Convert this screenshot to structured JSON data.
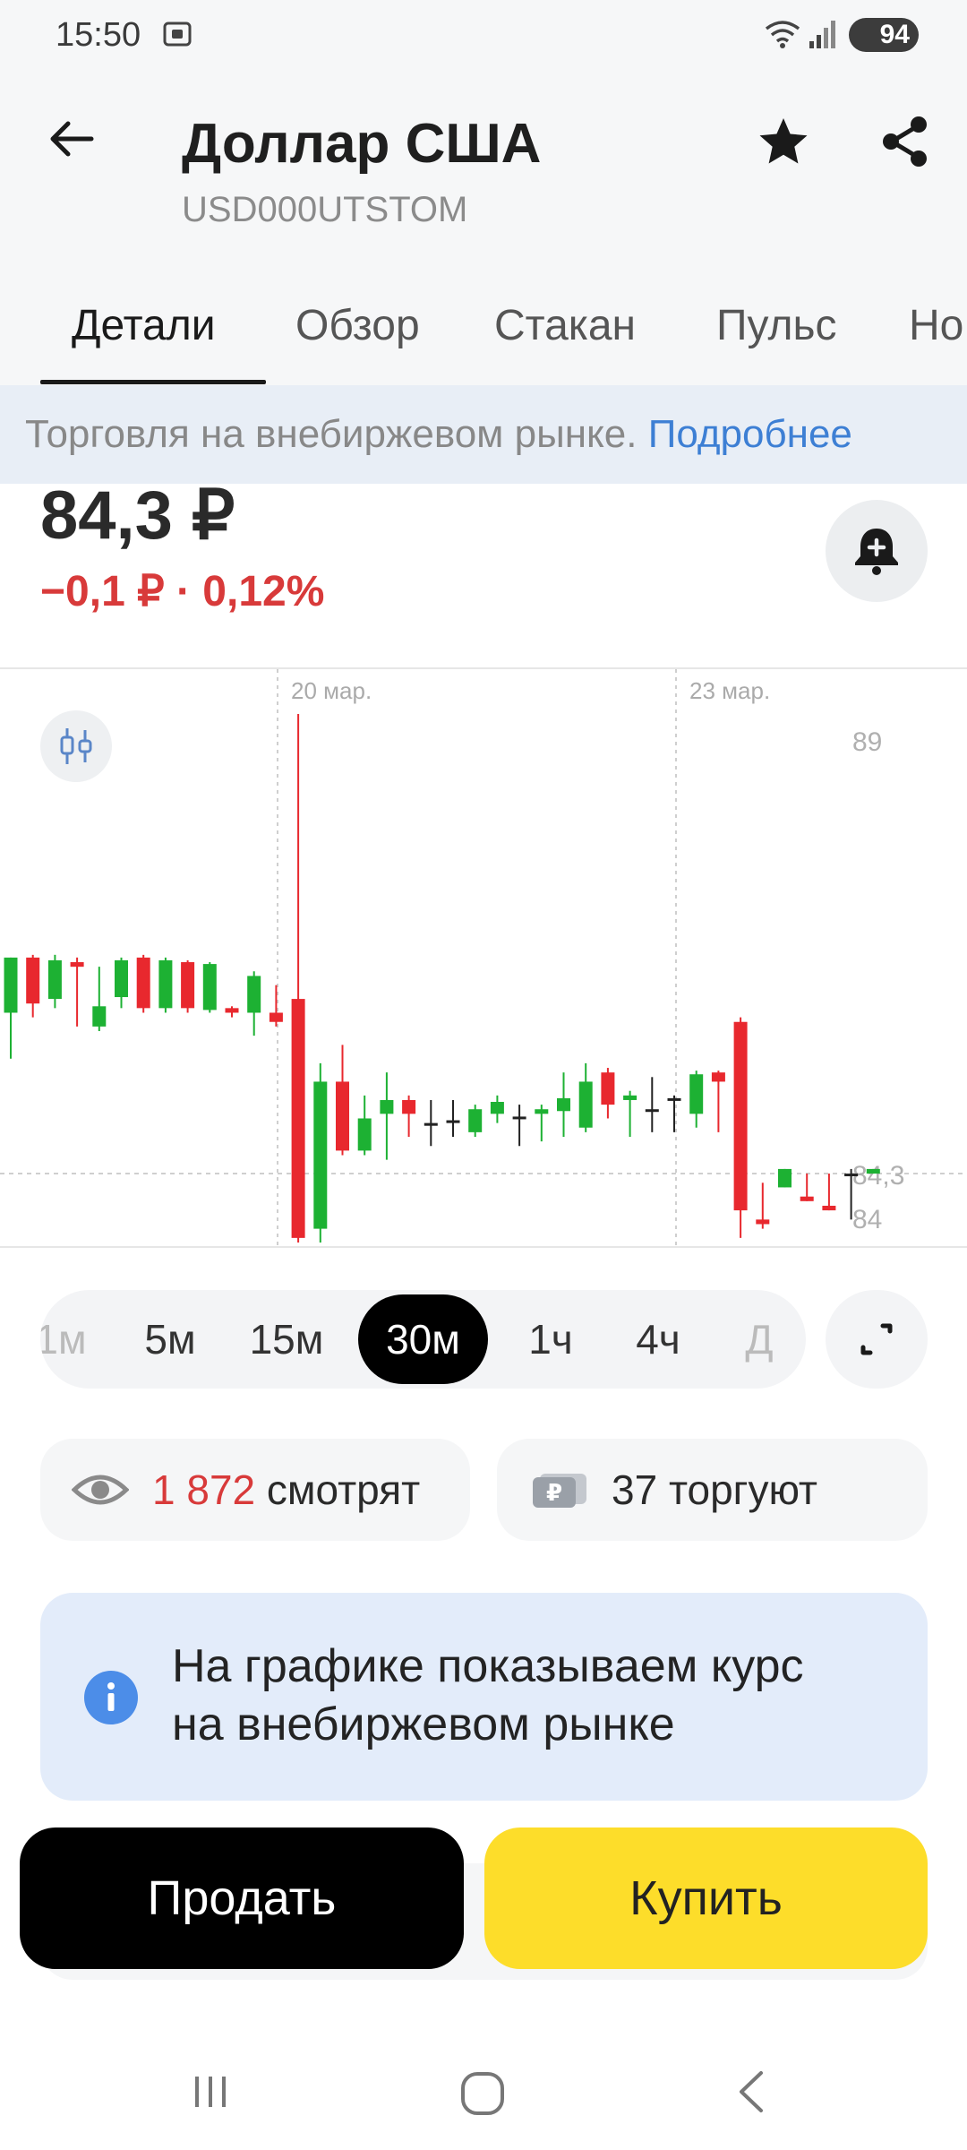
{
  "status_bar": {
    "time": "15:50",
    "battery": "94"
  },
  "header": {
    "title": "Доллар США",
    "ticker": "USD000UTSTOM"
  },
  "tabs": [
    {
      "label": "Детали",
      "active": true
    },
    {
      "label": "Обзор"
    },
    {
      "label": "Стакан"
    },
    {
      "label": "Пульс"
    },
    {
      "label": "Но"
    }
  ],
  "banner": {
    "text": "Торговля на внебиржевом рынке.",
    "link": "Подробнее"
  },
  "quote": {
    "price": "84,3 ₽",
    "change": "−0,1 ₽ · 0,12%"
  },
  "chart_data": {
    "type": "candlestick",
    "date_labels": [
      "20 мар.",
      "23 мар."
    ],
    "y_labels": [
      "89",
      "84,3",
      "84"
    ],
    "current_price": 84.3,
    "colors": {
      "up": "#1db133",
      "down": "#e8282e",
      "doji": "#222222"
    },
    "candles": [
      {
        "o": 86.05,
        "h": 86.15,
        "c": 86.65,
        "l": 85.55
      },
      {
        "o": 86.65,
        "h": 86.68,
        "c": 86.15,
        "l": 86.0
      },
      {
        "o": 86.2,
        "h": 86.68,
        "c": 86.62,
        "l": 86.1
      },
      {
        "o": 86.6,
        "h": 86.65,
        "c": 86.55,
        "l": 85.9
      },
      {
        "o": 85.9,
        "h": 86.55,
        "c": 86.12,
        "l": 85.85
      },
      {
        "o": 86.22,
        "h": 86.65,
        "c": 86.62,
        "l": 86.1
      },
      {
        "o": 86.65,
        "h": 86.68,
        "c": 86.1,
        "l": 86.05
      },
      {
        "o": 86.1,
        "h": 86.65,
        "c": 86.62,
        "l": 86.05
      },
      {
        "o": 86.6,
        "h": 86.62,
        "c": 86.1,
        "l": 86.05
      },
      {
        "o": 86.08,
        "h": 86.6,
        "c": 86.58,
        "l": 86.05
      },
      {
        "o": 86.1,
        "h": 86.12,
        "c": 86.05,
        "l": 86.0
      },
      {
        "o": 86.05,
        "h": 86.5,
        "c": 86.45,
        "l": 85.8
      },
      {
        "o": 86.05,
        "h": 86.35,
        "c": 85.95,
        "l": 85.9
      },
      {
        "o": 86.2,
        "h": 89.3,
        "c": 83.6,
        "l": 83.55
      },
      {
        "o": 83.7,
        "h": 85.5,
        "c": 85.3,
        "l": 83.55
      },
      {
        "o": 85.3,
        "h": 85.7,
        "c": 84.55,
        "l": 84.5
      },
      {
        "o": 84.55,
        "h": 85.15,
        "c": 84.9,
        "l": 84.5
      },
      {
        "o": 84.95,
        "h": 85.4,
        "c": 85.1,
        "l": 84.45
      },
      {
        "o": 85.1,
        "h": 85.15,
        "c": 84.95,
        "l": 84.7
      },
      {
        "o": 84.85,
        "h": 85.1,
        "c": 84.82,
        "l": 84.6
      },
      {
        "o": 84.85,
        "h": 85.1,
        "c": 84.88,
        "l": 84.7
      },
      {
        "o": 84.75,
        "h": 85.05,
        "c": 85.0,
        "l": 84.7
      },
      {
        "o": 84.95,
        "h": 85.15,
        "c": 85.08,
        "l": 84.85
      },
      {
        "o": 84.92,
        "h": 85.05,
        "c": 84.9,
        "l": 84.6
      },
      {
        "o": 84.95,
        "h": 85.05,
        "c": 85.0,
        "l": 84.65
      },
      {
        "o": 84.98,
        "h": 85.4,
        "c": 85.12,
        "l": 84.7
      },
      {
        "o": 84.8,
        "h": 85.5,
        "c": 85.3,
        "l": 84.75
      },
      {
        "o": 85.4,
        "h": 85.45,
        "c": 85.05,
        "l": 84.9
      },
      {
        "o": 85.1,
        "h": 85.2,
        "c": 85.15,
        "l": 84.7
      },
      {
        "o": 85.0,
        "h": 85.35,
        "c": 84.98,
        "l": 84.75
      },
      {
        "o": 85.1,
        "h": 85.15,
        "c": 85.12,
        "l": 84.75
      },
      {
        "o": 84.95,
        "h": 85.42,
        "c": 85.38,
        "l": 84.8
      },
      {
        "o": 85.4,
        "h": 85.42,
        "c": 85.3,
        "l": 84.75
      },
      {
        "o": 85.95,
        "h": 86.0,
        "c": 83.9,
        "l": 83.6
      },
      {
        "o": 83.8,
        "h": 84.2,
        "c": 83.75,
        "l": 83.7
      },
      {
        "o": 84.15,
        "h": 84.2,
        "c": 84.35,
        "l": 84.3
      },
      {
        "o": 84.05,
        "h": 84.1,
        "c": 84.0,
        "l": 84.3
      },
      {
        "o": 83.95,
        "h": 84.0,
        "c": 83.9,
        "l": 84.3
      },
      {
        "o": 84.3,
        "h": 83.8,
        "c": 84.3,
        "l": 84.35
      },
      {
        "o": 84.3,
        "h": 84.3,
        "c": 84.35,
        "l": 84.3
      }
    ]
  },
  "timeframes": [
    {
      "label": "1м",
      "state": "faded"
    },
    {
      "label": "5м"
    },
    {
      "label": "15м"
    },
    {
      "label": "30м",
      "state": "active"
    },
    {
      "label": "1ч"
    },
    {
      "label": "4ч"
    },
    {
      "label": "Д",
      "state": "faded"
    }
  ],
  "stats": {
    "watchers_count": "1 872",
    "watchers_label": "смотрят",
    "traders": "37 торгуют"
  },
  "info": {
    "line1": "На графике показываем курс",
    "line2": "на внебиржевом рынке"
  },
  "actions": {
    "sell": "Продать",
    "buy": "Купить"
  }
}
